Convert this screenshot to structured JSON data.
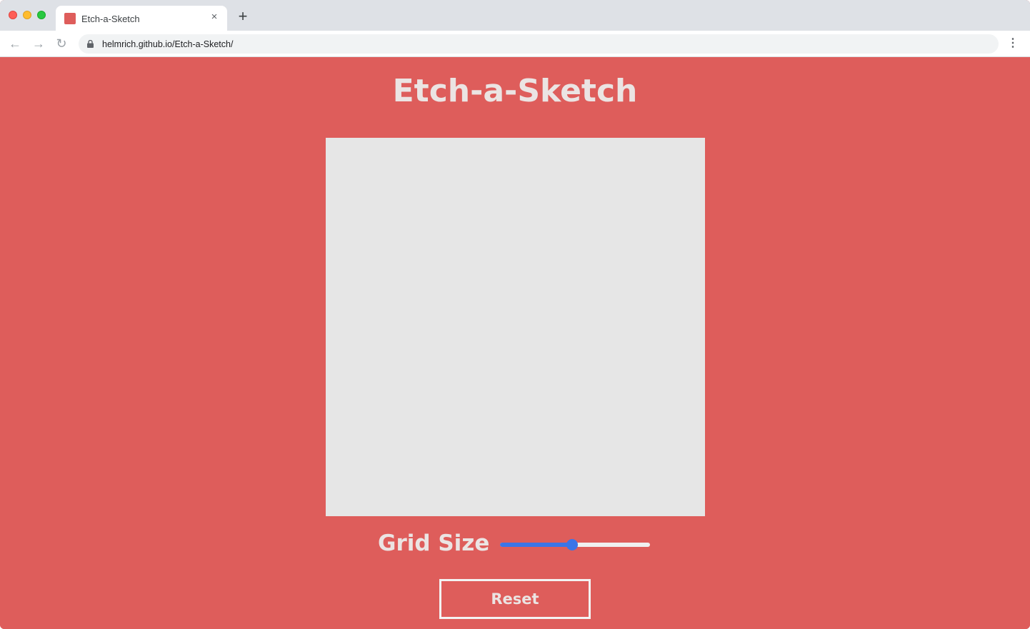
{
  "browser": {
    "tab_title": "Etch-a-Sketch",
    "url": "helmrich.github.io/Etch-a-Sketch/"
  },
  "page": {
    "title": "Etch-a-Sketch",
    "grid_size_label": "Grid Size",
    "grid_size_level": 0.48,
    "reset_label": "Reset"
  },
  "colors": {
    "background": "#de5d5b",
    "pad": "#e6e6e6",
    "slider_accent": "#3b75e8"
  },
  "icons": {
    "close": "×",
    "new_tab": "+",
    "back": "←",
    "forward": "→",
    "reload": "↻",
    "menu": "⋮"
  }
}
